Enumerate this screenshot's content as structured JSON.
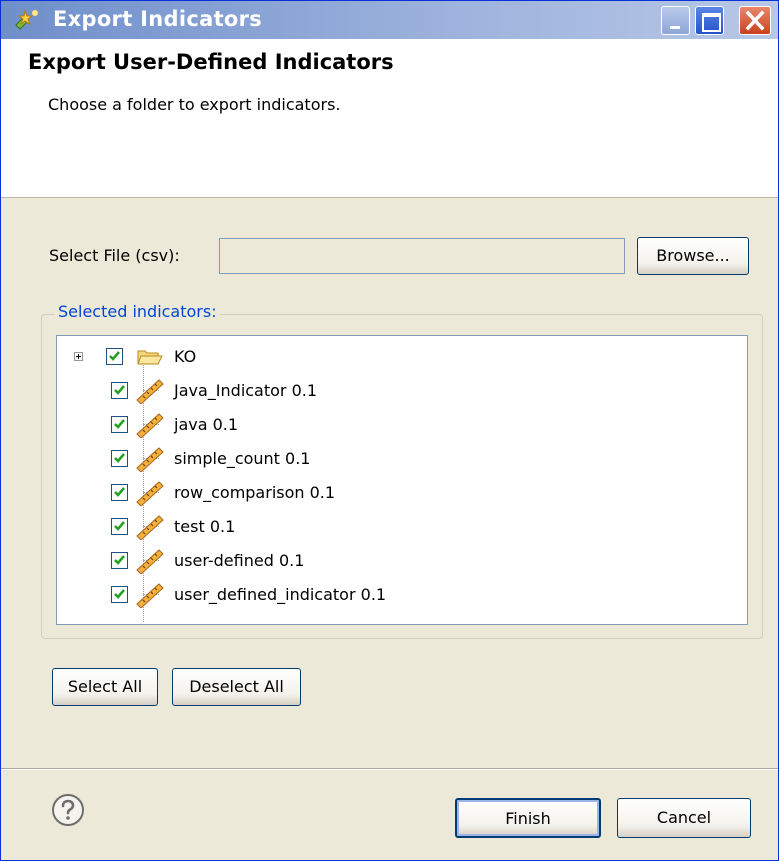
{
  "window": {
    "title": "Export Indicators"
  },
  "header": {
    "title": "Export User-Defined Indicators",
    "message": "Choose a folder to export indicators."
  },
  "file": {
    "label": "Select File (csv):",
    "value": "",
    "browse_label": "Browse..."
  },
  "indicators": {
    "group_label": "Selected indicators:",
    "items": [
      {
        "label": "KO",
        "type": "folder",
        "checked": true,
        "expandable": true
      },
      {
        "label": "Java_Indicator 0.1",
        "type": "indicator",
        "checked": true
      },
      {
        "label": "java 0.1",
        "type": "indicator",
        "checked": true
      },
      {
        "label": "simple_count 0.1",
        "type": "indicator",
        "checked": true
      },
      {
        "label": "row_comparison 0.1",
        "type": "indicator",
        "checked": true
      },
      {
        "label": "test 0.1",
        "type": "indicator",
        "checked": true
      },
      {
        "label": "user-defined 0.1",
        "type": "indicator",
        "checked": true
      },
      {
        "label": "user_defined_indicator 0.1",
        "type": "indicator",
        "checked": true
      }
    ]
  },
  "actions": {
    "select_all": "Select All",
    "deselect_all": "Deselect All"
  },
  "footer": {
    "finish": "Finish",
    "cancel": "Cancel"
  },
  "icons": {
    "title_icon": "export-wizard-icon",
    "help": "help-icon",
    "folder": "folder-icon",
    "indicator": "ruler-icon",
    "check": "checkmark-icon"
  },
  "colors": {
    "titlebar_start": "#6f8fcb",
    "titlebar_end": "#b7c7e6",
    "dialog_bg": "#ece9d8",
    "group_label": "#0046d5",
    "checkbox_check": "#21a121",
    "close_button": "#c8421e"
  }
}
